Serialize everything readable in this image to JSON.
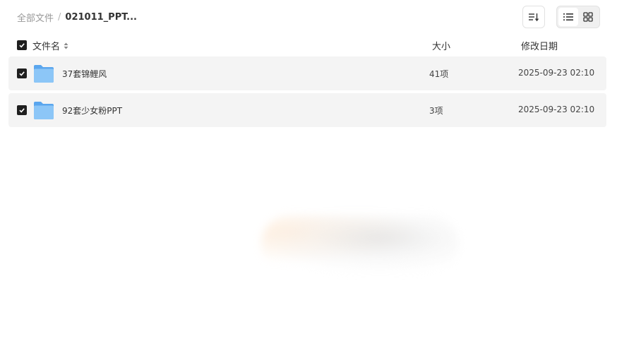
{
  "breadcrumb": {
    "root": "全部文件",
    "separator": "/",
    "current": "021011_PPT..."
  },
  "toolbar": {
    "sort_icon": "sort-lines-icon",
    "view_list_icon": "list-view-icon",
    "view_grid_icon": "grid-view-icon",
    "active_view": "list"
  },
  "header": {
    "name": "文件名",
    "size": "大小",
    "date": "修改日期",
    "select_all_checked": true
  },
  "rows": [
    {
      "name": "37套锦鲤风",
      "size": "41项",
      "date": "2025-09-23 02:10",
      "type": "folder",
      "checked": true
    },
    {
      "name": "92套少女粉PPT",
      "size": "3项",
      "date": "2025-09-23 02:10",
      "type": "folder",
      "checked": true
    }
  ],
  "colors": {
    "row_bg": "#f4f4f4",
    "checkbox": "#1f1f1f",
    "folder_blue": "#6db3f2"
  }
}
